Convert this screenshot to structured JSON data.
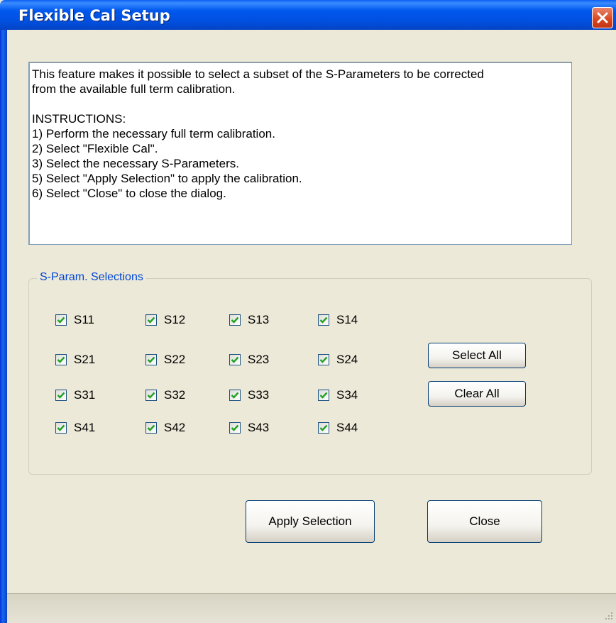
{
  "window": {
    "title": "Flexible Cal Setup"
  },
  "description": {
    "lines": [
      "This feature makes it possible to select a subset of the S-Parameters to be corrected",
      "from the available full term calibration.",
      "",
      "INSTRUCTIONS:",
      "1) Perform the necessary full term calibration.",
      "2) Select \"Flexible Cal\".",
      "3) Select the necessary  S-Parameters.",
      "5) Select \"Apply Selection\" to apply the calibration.",
      "6) Select \"Close\" to close the dialog."
    ]
  },
  "selections": {
    "legend": "S-Param. Selections",
    "rows": [
      [
        {
          "label": "S11",
          "checked": true
        },
        {
          "label": "S12",
          "checked": true
        },
        {
          "label": "S13",
          "checked": true
        },
        {
          "label": "S14",
          "checked": true
        }
      ],
      [
        {
          "label": "S21",
          "checked": true
        },
        {
          "label": "S22",
          "checked": true
        },
        {
          "label": "S23",
          "checked": true
        },
        {
          "label": "S24",
          "checked": true
        }
      ],
      [
        {
          "label": "S31",
          "checked": true
        },
        {
          "label": "S32",
          "checked": true
        },
        {
          "label": "S33",
          "checked": true
        },
        {
          "label": "S34",
          "checked": true
        }
      ],
      [
        {
          "label": "S41",
          "checked": true
        },
        {
          "label": "S42",
          "checked": true
        },
        {
          "label": "S43",
          "checked": true
        },
        {
          "label": "S44",
          "checked": true
        }
      ]
    ],
    "select_all_label": "Select All",
    "clear_all_label": "Clear All"
  },
  "buttons": {
    "apply_label": "Apply Selection",
    "close_label": "Close"
  },
  "colors": {
    "titlebar": "#0058EE",
    "dialog_bg": "#ECE9D8",
    "legend_text": "#0046D5",
    "check_mark": "#21A121"
  },
  "icons": {
    "close": "close-x-icon",
    "checkbox": "checkmark-icon",
    "grip": "resize-grip-icon"
  }
}
